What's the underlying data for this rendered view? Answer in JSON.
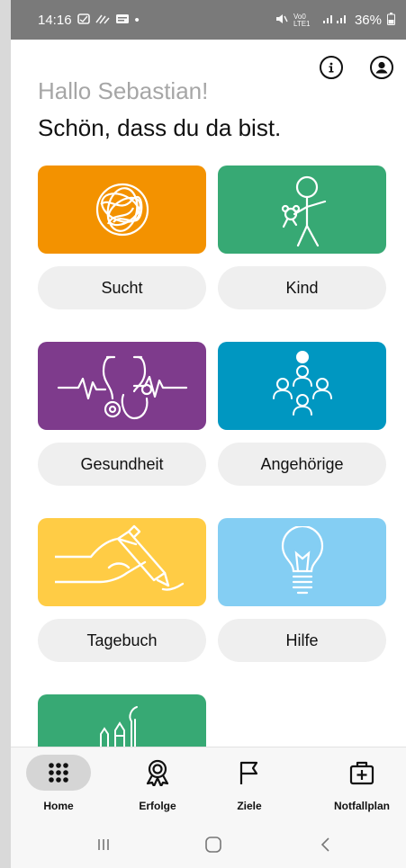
{
  "status_bar": {
    "time": "14:16",
    "dot": "•",
    "signal_label": "Vo0 LTE1",
    "battery": "36%"
  },
  "header": {
    "greeting": "Hallo Sebastian!",
    "subtitle": "Schön, dass du da bist.",
    "info_icon": "info-icon",
    "profile_icon": "profile-icon"
  },
  "tiles": [
    {
      "label": "Sucht",
      "color": "#F39200",
      "icon": "tangle-icon"
    },
    {
      "label": "Kind",
      "color": "#37A974",
      "icon": "child-icon"
    },
    {
      "label": "Gesundheit",
      "color": "#7E3B8C",
      "icon": "stethoscope-icon"
    },
    {
      "label": "Angehörige",
      "color": "#0097C1",
      "icon": "group-icon"
    },
    {
      "label": "Tagebuch",
      "color": "#FFCC45",
      "icon": "writing-hand-icon"
    },
    {
      "label": "Hilfe",
      "color": "#84CEF3",
      "icon": "lightbulb-icon"
    },
    {
      "label": "",
      "color": "#37A974",
      "icon": "art-tools-icon"
    }
  ],
  "bottom_nav": [
    {
      "label": "Home",
      "icon": "home-grid-icon",
      "active": true
    },
    {
      "label": "Erfolge",
      "icon": "award-icon",
      "active": false
    },
    {
      "label": "Ziele",
      "icon": "flag-icon",
      "active": false
    },
    {
      "label": "Notfallplan",
      "icon": "first-aid-icon",
      "active": false
    }
  ],
  "system_nav": {
    "recents": "|||",
    "home": "○",
    "back": "<"
  }
}
